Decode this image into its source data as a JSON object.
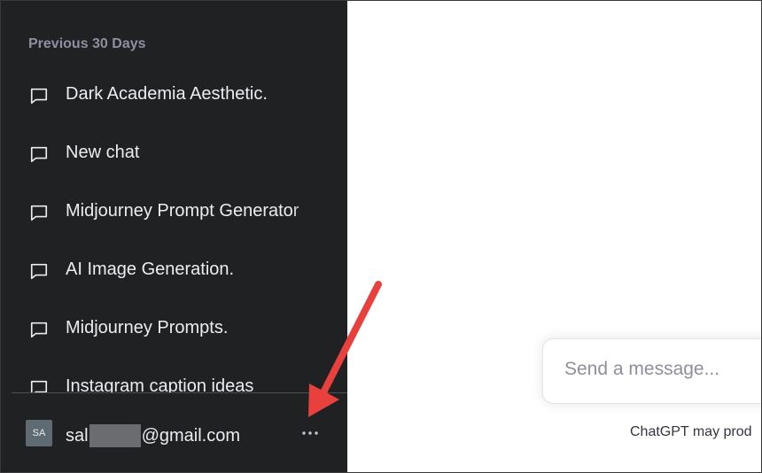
{
  "sidebar": {
    "section_label": "Previous 30 Days",
    "chats": [
      {
        "label": "Dark Academia Aesthetic.",
        "icon": "chat-bubble-icon"
      },
      {
        "label": "New chat",
        "icon": "chat-bubble-icon"
      },
      {
        "label": "Midjourney Prompt Generator",
        "icon": "chat-bubble-icon"
      },
      {
        "label": "AI Image Generation.",
        "icon": "chat-bubble-icon"
      },
      {
        "label": "Midjourney Prompts.",
        "icon": "chat-bubble-icon"
      },
      {
        "label": "Instagram caption ideas",
        "icon": "chat-bubble-icon"
      }
    ]
  },
  "account": {
    "avatar_initials": "SA",
    "email_prefix": "sal",
    "email_domain": "@gmail.com",
    "more_icon": "ellipsis-icon"
  },
  "main": {
    "composer_placeholder": "Send a message...",
    "disclaimer": "ChatGPT may prod"
  },
  "colors": {
    "sidebar_bg": "#202123",
    "sidebar_text": "#ececf1",
    "muted_text": "#8e8ea0",
    "annotation_arrow": "#e8413d"
  }
}
